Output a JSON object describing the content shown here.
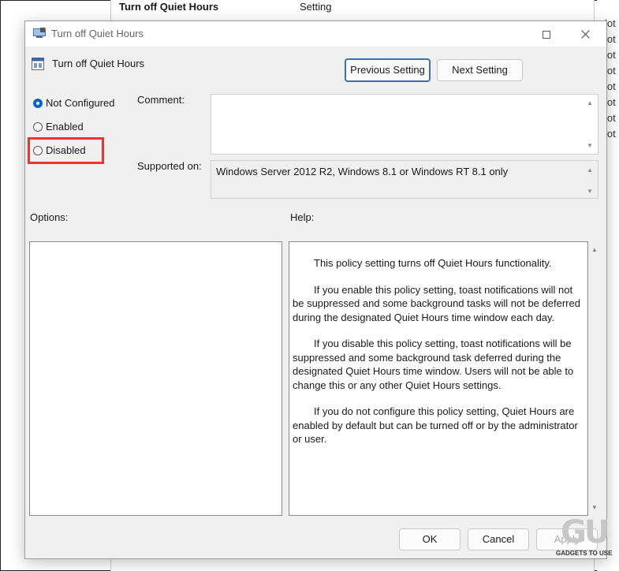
{
  "background": {
    "policy_title": "Turn off Quiet Hours",
    "state_column": "Setting",
    "right_column_fragments": [
      "lot",
      "lot",
      "lot",
      "lot",
      "lot",
      "lot",
      "lot",
      "lot"
    ]
  },
  "dialog": {
    "window_title": "Turn off Quiet Hours",
    "policy_name": "Turn off Quiet Hours",
    "previous_button": "Previous Setting",
    "next_button": "Next Setting",
    "radios": {
      "not_configured": "Not Configured",
      "enabled": "Enabled",
      "disabled": "Disabled",
      "selected": "Not Configured"
    },
    "comment_label": "Comment:",
    "comment_value": "",
    "supported_label": "Supported on:",
    "supported_value": "Windows Server 2012 R2, Windows 8.1 or Windows RT 8.1 only",
    "options_label": "Options:",
    "help_label": "Help:",
    "help_paragraphs": [
      "This policy setting turns off Quiet Hours functionality.",
      "If you enable this policy setting, toast notifications will not be suppressed and some background tasks will not be deferred during the designated Quiet Hours time window each day.",
      "If you disable this policy setting, toast notifications will be suppressed and some background task deferred during the designated Quiet Hours time window.  Users will not be able to change this or any other Quiet Hours settings.",
      "If you do not configure this policy setting, Quiet Hours are enabled by default but can be turned off or by the administrator or user."
    ],
    "ok_button": "OK",
    "cancel_button": "Cancel",
    "apply_button": "Apply"
  },
  "watermark": {
    "logo": "GU",
    "text": "GADGETS TO USE"
  },
  "colors": {
    "highlight": "#ef3333",
    "radio_selected": "#0b63c9",
    "dialog_bg": "#f0f0f0"
  }
}
